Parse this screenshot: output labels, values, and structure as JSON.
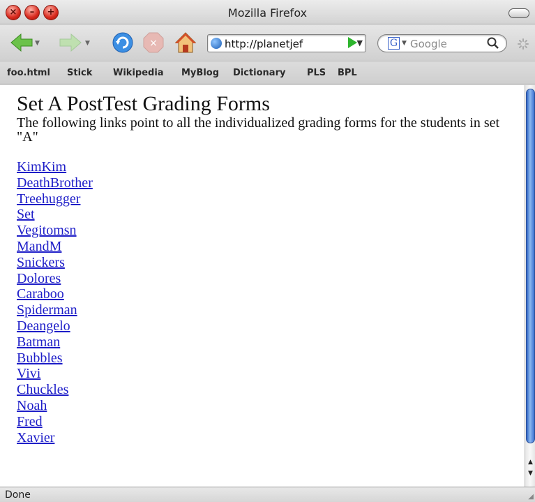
{
  "window": {
    "title": "Mozilla Firefox"
  },
  "toolbar": {
    "url": "http://planetjef",
    "search_placeholder": "Google"
  },
  "bookmarks": [
    "foo.html",
    "Stick",
    "Wikipedia",
    "MyBlog",
    "Dictionary",
    "PLS",
    "BPL"
  ],
  "page": {
    "heading": "Set A PostTest Grading Forms",
    "intro": "The following links point to all the individualized grading forms for the students in set \"A\"",
    "links": [
      "KimKim",
      "DeathBrother",
      "Treehugger",
      "Set",
      "Vegitomsn",
      "MandM",
      "Snickers",
      "Dolores",
      "Caraboo",
      "Spiderman",
      "Deangelo",
      "Batman",
      "Bubbles",
      "Vivi",
      "Chuckles",
      "Noah",
      "Fred",
      "Xavier"
    ]
  },
  "status": {
    "text": "Done"
  },
  "colors": {
    "link": "#1e1ec8",
    "scroll_thumb": "#3d72d2",
    "go_arrow": "#2db52d"
  },
  "icons": [
    "close-icon",
    "minimize-icon",
    "zoom-icon",
    "back-arrow-icon",
    "forward-arrow-icon",
    "reload-icon",
    "stop-icon",
    "home-icon",
    "globe-icon",
    "go-arrow-icon",
    "google-icon",
    "search-icon",
    "spinner-icon"
  ]
}
